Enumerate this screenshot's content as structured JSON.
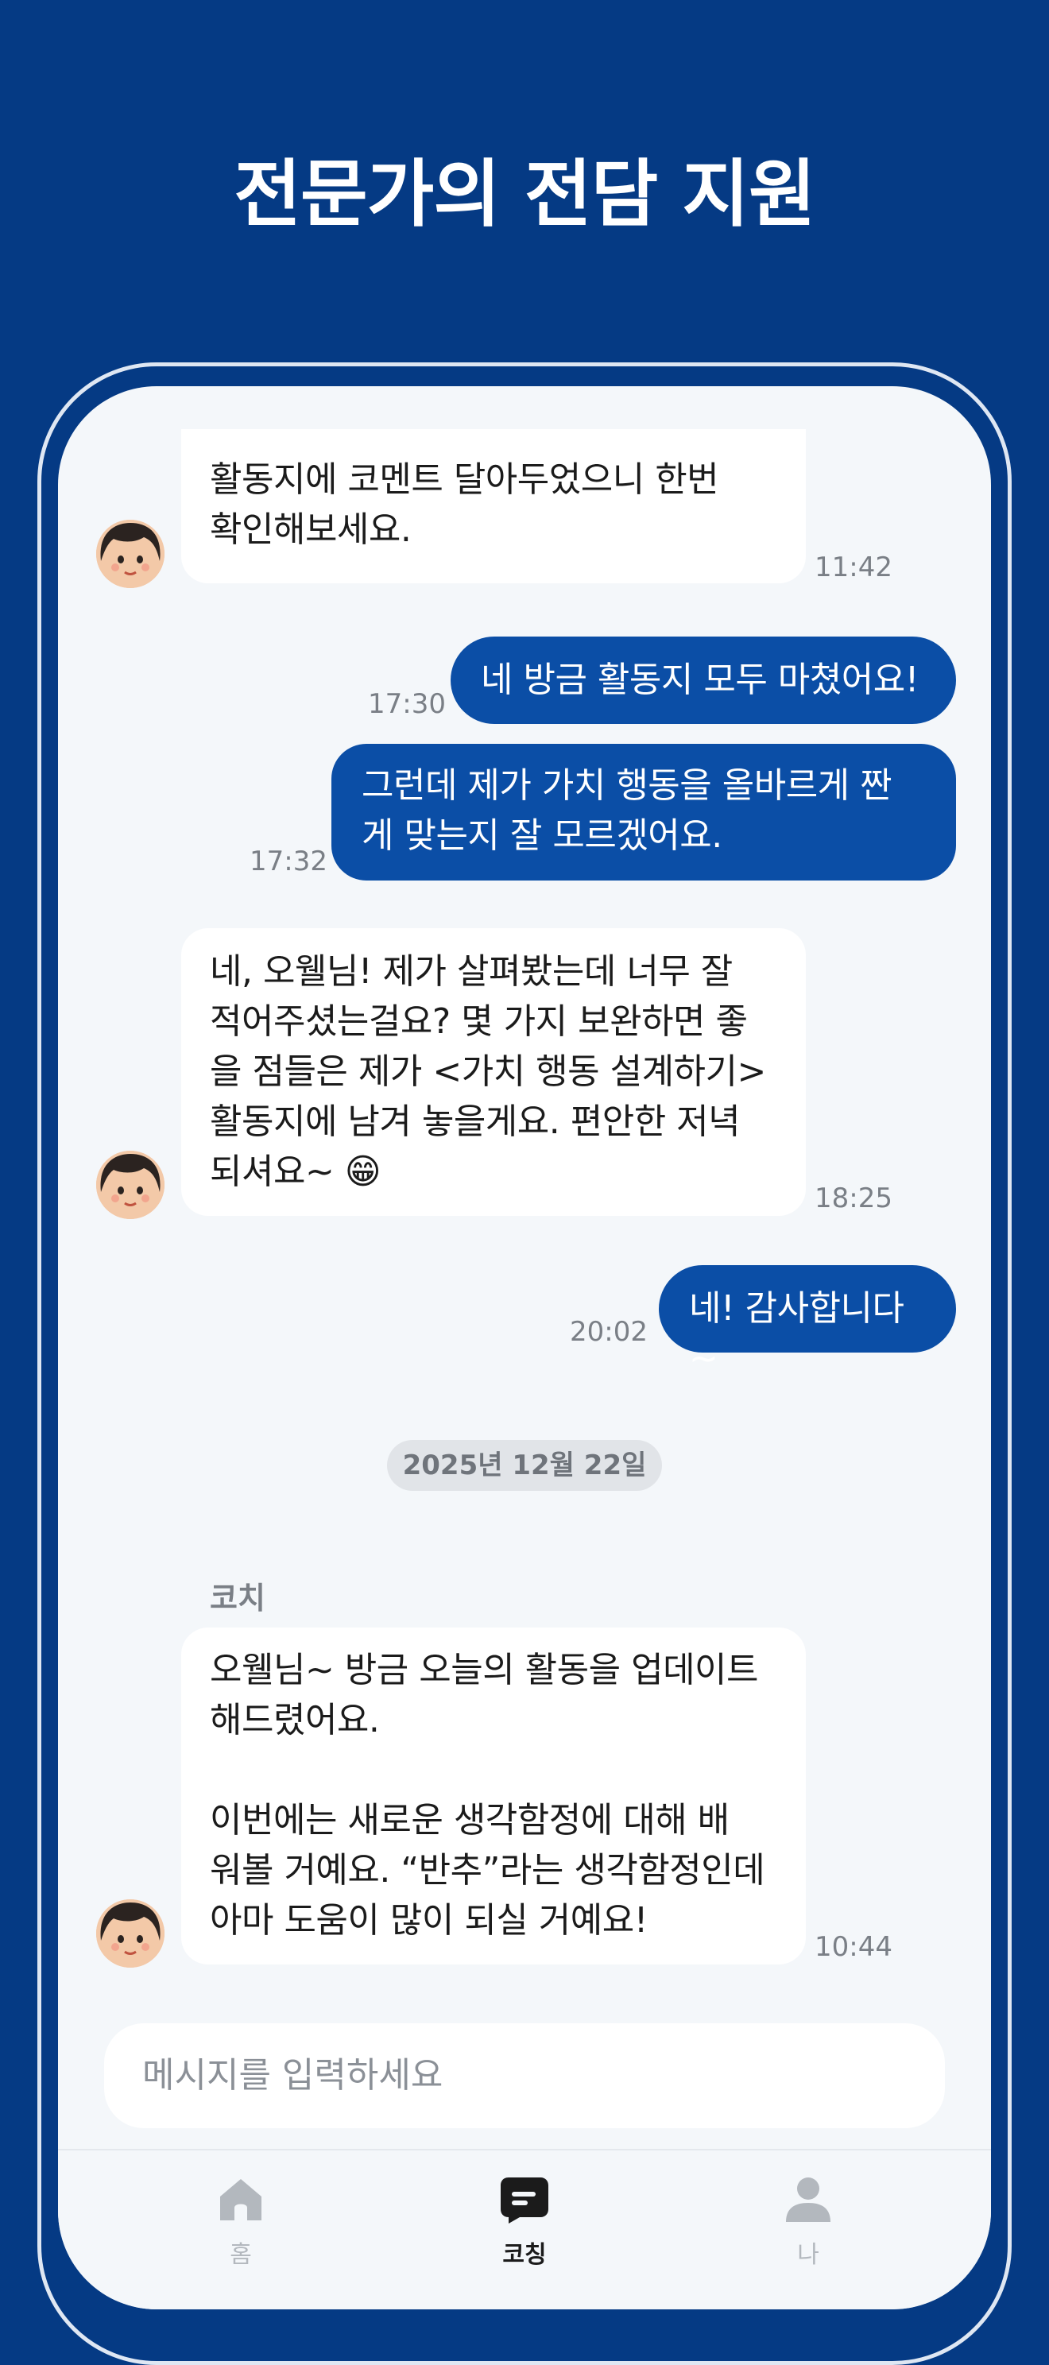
{
  "headline": "전문가의 전담 지원",
  "messages": [
    {
      "from": "coach",
      "text": "활동지에 코멘트 달아두었으니 한번\n확인해보세요.",
      "time": "11:42"
    },
    {
      "from": "me",
      "text": "네 방금 활동지 모두 마쳤어요!",
      "time": "17:30"
    },
    {
      "from": "me",
      "text": "그런데 제가 가치 행동을 올바르게 짠\n게 맞는지 잘 모르겠어요.",
      "time": "17:32"
    },
    {
      "from": "coach",
      "text": "네, 오웰님! 제가 살펴봤는데 너무 잘\n적어주셨는걸요? 몇 가지 보완하면 좋\n을 점들은 제가 <가치 행동 설계하기>\n활동지에 남겨 놓을게요. 편안한 저녁\n되셔요~ 😁",
      "time": "18:25"
    },
    {
      "from": "me",
      "text": "네! 감사합니다~",
      "time": "20:02"
    },
    {
      "from": "coach",
      "text": "오웰님~ 방금 오늘의 활동을 업데이트\n해드렸어요.\n\n이번에는 새로운 생각함정에 대해 배\n워볼 거예요. “반추”라는 생각함정인데\n아마 도움이 많이 되실 거예요!",
      "time": "10:44"
    }
  ],
  "date_divider": "2025년 12월 22일",
  "sender_name": "코치",
  "input_placeholder": "메시지를 입력하세요",
  "tabs": [
    {
      "label": "홈",
      "icon": "home-icon",
      "active": false
    },
    {
      "label": "코칭",
      "icon": "chat-icon",
      "active": true
    },
    {
      "label": "나",
      "icon": "person-icon",
      "active": false
    }
  ],
  "colors": {
    "background": "#053a84",
    "outgoing": "#0b4ea6",
    "incoming": "#ffffff",
    "active_tab": "#1b1b1b",
    "inactive_tab": "#b3b8be"
  }
}
